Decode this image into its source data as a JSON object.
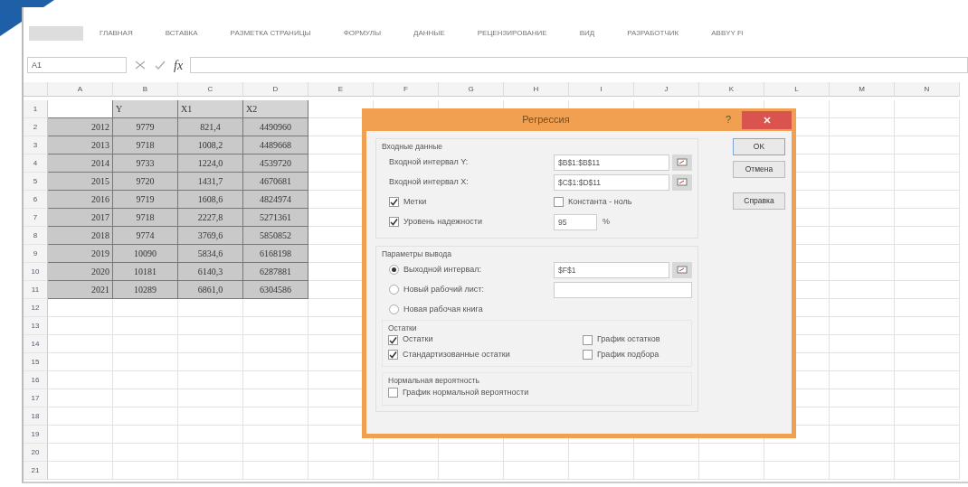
{
  "ribbon": {
    "tabs": [
      "ГЛАВНАЯ",
      "ВСТАВКА",
      "РАЗМЕТКА СТРАНИЦЫ",
      "ФОРМУЛЫ",
      "ДАННЫЕ",
      "РЕЦЕНЗИРОВАНИЕ",
      "ВИД",
      "РАЗРАБОТЧИК",
      "ABBYY Fi"
    ]
  },
  "formula_bar": {
    "name_box": "A1",
    "fx": "fx"
  },
  "sheet": {
    "columns": [
      "A",
      "B",
      "C",
      "D",
      "E",
      "F",
      "G",
      "H",
      "I",
      "J",
      "K",
      "L",
      "M",
      "N"
    ],
    "row_numbers": [
      "1",
      "2",
      "3",
      "4",
      "5",
      "6",
      "7",
      "8",
      "9",
      "10",
      "11",
      "12",
      "13",
      "14",
      "15",
      "16",
      "17",
      "18",
      "19",
      "20",
      "21"
    ],
    "range_selected": true,
    "header": [
      "Y",
      "X1",
      "X2"
    ],
    "rows": [
      [
        "2012",
        "9779",
        "821,4",
        "4490960"
      ],
      [
        "2013",
        "9718",
        "1008,2",
        "4489668"
      ],
      [
        "2014",
        "9733",
        "1224,0",
        "4539720"
      ],
      [
        "2015",
        "9720",
        "1431,7",
        "4670681"
      ],
      [
        "2016",
        "9719",
        "1608,6",
        "4824974"
      ],
      [
        "2017",
        "9718",
        "2227,8",
        "5271361"
      ],
      [
        "2018",
        "9774",
        "3769,6",
        "5850852"
      ],
      [
        "2019",
        "10090",
        "5834,6",
        "6168198"
      ],
      [
        "2020",
        "10181",
        "6140,3",
        "6287881"
      ],
      [
        "2021",
        "10289",
        "6861,0",
        "6304586"
      ]
    ]
  },
  "dialog": {
    "title": "Регрессия",
    "help": "?",
    "input_group": {
      "title": "Входные данные",
      "fields": [
        {
          "label": "Входной интервал Y:",
          "value": "$B$1:$B$11"
        },
        {
          "label": "Входной интервал X:",
          "value": "$C$1:$D$11"
        }
      ],
      "labels": {
        "label": "Метки",
        "checked": true
      },
      "constant_zero": {
        "label": "Константа - ноль",
        "checked": false
      },
      "confidence": {
        "label": "Уровень надежности",
        "checked": true,
        "value": "95",
        "unit": "%"
      }
    },
    "output_group": {
      "title": "Параметры вывода",
      "options": [
        {
          "label": "Выходной интервал:",
          "selected": true,
          "value": "$F$1"
        },
        {
          "label": "Новый рабочий лист:",
          "selected": false
        },
        {
          "label": "Новая рабочая книга",
          "selected": false
        }
      ],
      "residuals_title": "Остатки",
      "residuals": [
        {
          "label": "Остатки",
          "checked": true
        },
        {
          "label": "График остатков",
          "checked": false
        },
        {
          "label": "Стандартизованные остатки",
          "checked": true
        },
        {
          "label": "График подбора",
          "checked": false
        }
      ],
      "normal_title": "Нормальная вероятность",
      "normal": {
        "label": "График нормальной вероятности",
        "checked": false
      }
    },
    "buttons": [
      "OK",
      "Отмена",
      "Справка"
    ]
  }
}
